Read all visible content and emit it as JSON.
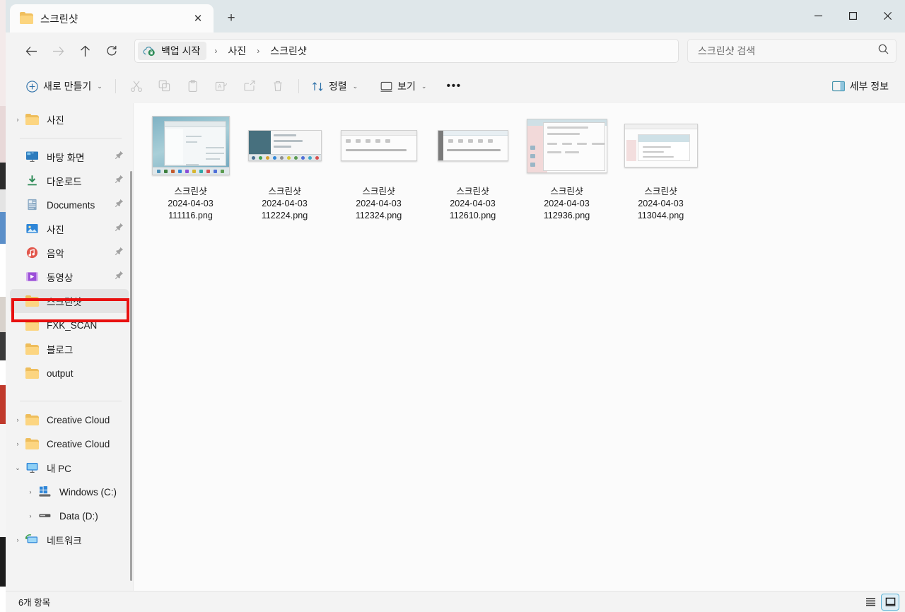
{
  "window": {
    "tab_title": "스크린샷",
    "tab_close_label": "✕",
    "new_tab_label": "+",
    "minimize_label": "minimize",
    "maximize_label": "maximize",
    "close_label": "close"
  },
  "nav": {
    "back_label": "←",
    "forward_label": "→",
    "up_label": "↑",
    "refresh_label": "⟳",
    "breadcrumb": {
      "root": "백업 시작",
      "separator": "›",
      "items": [
        "사진",
        "스크린샷"
      ]
    }
  },
  "search": {
    "placeholder": "스크린샷 검색",
    "value": "",
    "icon": "search-icon"
  },
  "toolbar": {
    "new_label": "새로 만들기",
    "cut_label": "잘라내기",
    "copy_label": "복사",
    "paste_label": "붙여넣기",
    "rename_label": "이름 바꾸기",
    "share_label": "공유",
    "delete_label": "삭제",
    "sort_label": "정렬",
    "view_label": "보기",
    "more_label": "•••",
    "details_label": "세부 정보",
    "caret": "⌄"
  },
  "sidebar": {
    "groups": [
      {
        "items": [
          {
            "label": "사진",
            "icon": "folder-icon",
            "chevron": "›",
            "pinned": false,
            "selected": false
          }
        ]
      },
      {
        "items": [
          {
            "label": "바탕 화면",
            "icon": "desktop-icon",
            "chevron": "",
            "pinned": true,
            "selected": false
          },
          {
            "label": "다운로드",
            "icon": "downloads-icon",
            "chevron": "",
            "pinned": true,
            "selected": false
          },
          {
            "label": "Documents",
            "icon": "documents-icon",
            "chevron": "",
            "pinned": true,
            "selected": false
          },
          {
            "label": "사진",
            "icon": "pictures-icon",
            "chevron": "",
            "pinned": true,
            "selected": false
          },
          {
            "label": "음악",
            "icon": "music-icon",
            "chevron": "",
            "pinned": true,
            "selected": false
          },
          {
            "label": "동영상",
            "icon": "videos-icon",
            "chevron": "",
            "pinned": true,
            "selected": false
          },
          {
            "label": "스크린샷",
            "icon": "folder-icon",
            "chevron": "",
            "pinned": false,
            "selected": true
          },
          {
            "label": "FXK_SCAN",
            "icon": "folder-icon",
            "chevron": "",
            "pinned": false,
            "selected": false
          },
          {
            "label": "블로그",
            "icon": "folder-icon",
            "chevron": "",
            "pinned": false,
            "selected": false
          },
          {
            "label": "output",
            "icon": "folder-icon",
            "chevron": "",
            "pinned": false,
            "selected": false
          }
        ]
      },
      {
        "items": [
          {
            "label": "Creative Cloud",
            "icon": "folder-icon",
            "chevron": "›",
            "pinned": false,
            "selected": false
          },
          {
            "label": "Creative Cloud",
            "icon": "folder-icon",
            "chevron": "›",
            "pinned": false,
            "selected": false
          },
          {
            "label": "내 PC",
            "icon": "thispc-icon",
            "chevron": "⌄",
            "pinned": false,
            "selected": false
          },
          {
            "label": "Windows (C:)",
            "icon": "windows-drive-icon",
            "chevron": "›",
            "pinned": false,
            "selected": false,
            "indent": true
          },
          {
            "label": "Data (D:)",
            "icon": "drive-icon",
            "chevron": "›",
            "pinned": false,
            "selected": false,
            "indent": true
          },
          {
            "label": "네트워크",
            "icon": "network-icon",
            "chevron": "›",
            "pinned": false,
            "selected": false
          }
        ]
      }
    ]
  },
  "files": [
    {
      "name": "스크린샷\n2024-04-03\n111116.png",
      "thumb": "desktop"
    },
    {
      "name": "스크린샷\n2024-04-03\n112224.png",
      "thumb": "small"
    },
    {
      "name": "스크린샷\n2024-04-03\n112324.png",
      "thumb": "doc"
    },
    {
      "name": "스크린샷\n2024-04-03\n112610.png",
      "thumb": "doc2"
    },
    {
      "name": "스크린샷\n2024-04-03\n112936.png",
      "thumb": "exp"
    },
    {
      "name": "스크린샷\n2024-04-03\n113044.png",
      "thumb": "exp2"
    }
  ],
  "status": {
    "item_count": "6개 항목",
    "list_view_label": "목록 보기",
    "tile_view_label": "큰 아이콘 보기"
  },
  "colors": {
    "accent": "#5ab3d6",
    "annotation_red": "#e8100f",
    "titlebar": "#dfe7ea",
    "chrome": "#f3f3f3",
    "content": "#fbfbfb"
  }
}
